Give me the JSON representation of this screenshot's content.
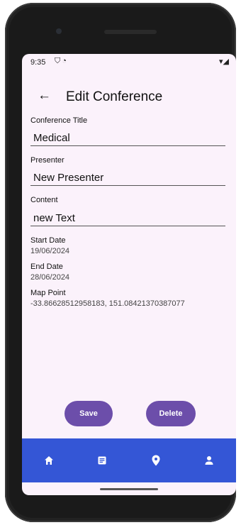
{
  "status_bar": {
    "time": "9:35",
    "icons": [
      "shield-icon",
      "circle-icon"
    ]
  },
  "app_bar": {
    "back_icon": "arrow-left-icon",
    "title": "Edit Conference"
  },
  "form": {
    "title_label": "Conference Title",
    "title_value": "Medical",
    "presenter_label": "Presenter",
    "presenter_value": "New Presenter",
    "content_label": "Content",
    "content_value": "new Text",
    "start_label": "Start Date",
    "start_value": "19/06/2024",
    "end_label": "End Date",
    "end_value": "28/06/2024",
    "map_label": "Map Point",
    "map_value": "-33.86628512958183, 151.08421370387077"
  },
  "actions": {
    "save_label": "Save",
    "delete_label": "Delete"
  },
  "bottom_nav": {
    "items": [
      {
        "icon": "home-icon"
      },
      {
        "icon": "notes-icon"
      },
      {
        "icon": "location-pin-icon"
      },
      {
        "icon": "person-icon"
      }
    ]
  },
  "colors": {
    "accent": "#6c4eaa",
    "nav_background": "#3456d6",
    "screen_background": "#fbf2fb"
  }
}
